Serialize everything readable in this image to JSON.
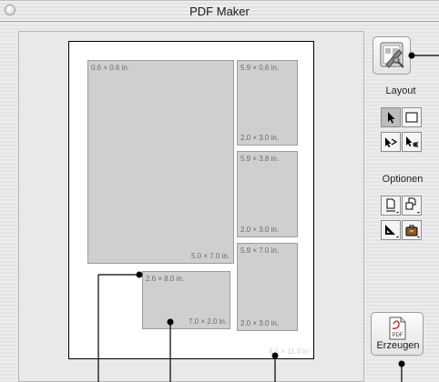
{
  "window": {
    "title": "PDF Maker"
  },
  "page": {
    "size_label": "8.5 × 11.0 in.",
    "regions": [
      {
        "top_label": "0.6 × 0.6 in.",
        "bottom_label": "5.0 × 7.0 in."
      },
      {
        "top_label": "5.9 × 0.6 in.",
        "bottom_label": "2.0 × 3.0 in."
      },
      {
        "top_label": "5.9 × 3.8 in.",
        "bottom_label": "2.0 × 3.0 in."
      },
      {
        "top_label": "5.9 × 7.0 in.",
        "bottom_label": "2.0 × 3.0 in."
      },
      {
        "top_label": "2.6 × 8.0 in.",
        "bottom_label": "7.0 × 2.0 in."
      }
    ]
  },
  "sidebar": {
    "layout_label": "Layout",
    "options_label": "Optionen",
    "create_label": "Erzeugen",
    "pdf_icon_text": "PDF",
    "layout_tools": [
      {
        "name": "arrow-tool",
        "icon": "arrow-cursor-icon",
        "active": true
      },
      {
        "name": "rectangle-tool",
        "icon": "rectangle-icon",
        "active": false
      },
      {
        "name": "move-tool",
        "icon": "move-arrow-icon",
        "active": false
      },
      {
        "name": "split-tool",
        "icon": "scissors-arrow-icon",
        "active": false
      }
    ],
    "option_tools": [
      {
        "name": "page-size-option",
        "icon": "page-size-icon"
      },
      {
        "name": "page-orientation-option",
        "icon": "page-orientation-icon"
      },
      {
        "name": "ruler-option",
        "icon": "triangle-ruler-icon"
      },
      {
        "name": "bag-option",
        "icon": "bag-icon"
      }
    ]
  },
  "colors": {
    "region_fill": "#cfcfcf",
    "page_border": "#000000",
    "callout": "#000000"
  }
}
